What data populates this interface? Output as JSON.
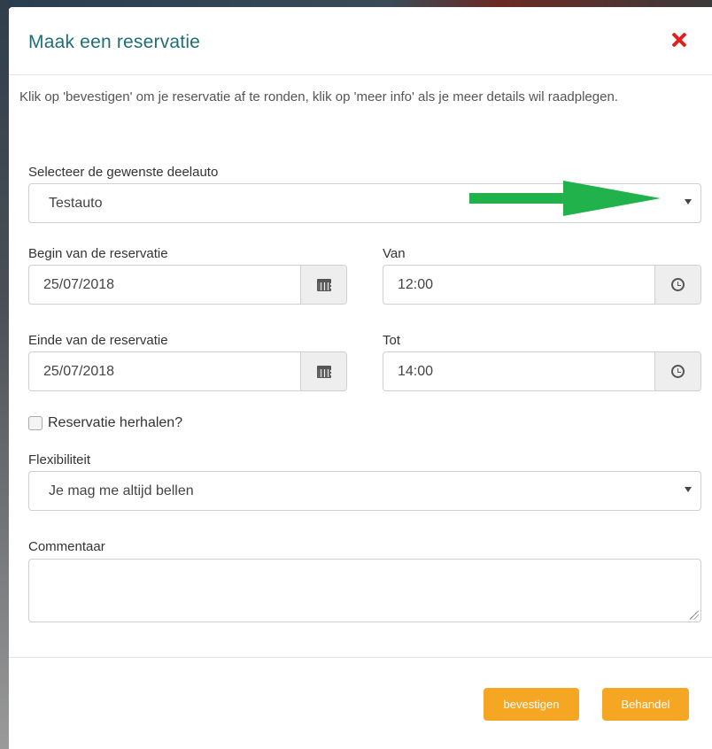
{
  "modal": {
    "title": "Maak een reservatie",
    "intro": "Klik op 'bevestigen' om je reservatie af te ronden, klik op 'meer info' als je meer details wil raadplegen."
  },
  "car": {
    "label": "Selecteer de gewenste deelauto",
    "value": "Testauto"
  },
  "begin": {
    "label": "Begin van de reservatie",
    "date": "25/07/2018",
    "time_label": "Van",
    "time": "12:00"
  },
  "end": {
    "label": "Einde van de reservatie",
    "date": "25/07/2018",
    "time_label": "Tot",
    "time": "14:00"
  },
  "repeat": {
    "label": "Reservatie herhalen?",
    "checked": false
  },
  "flex": {
    "label": "Flexibiliteit",
    "value": "Je mag me altijd bellen"
  },
  "comment": {
    "label": "Commentaar",
    "value": ""
  },
  "buttons": {
    "confirm": "bevestigen",
    "other": "Behandel"
  },
  "colors": {
    "title": "#1f6f73",
    "close": "#e02020",
    "button": "#f5a623",
    "arrow": "#22b24c"
  },
  "icons": [
    "close-icon",
    "chevron-down-icon",
    "calendar-icon",
    "clock-icon",
    "arrow-annotation"
  ]
}
